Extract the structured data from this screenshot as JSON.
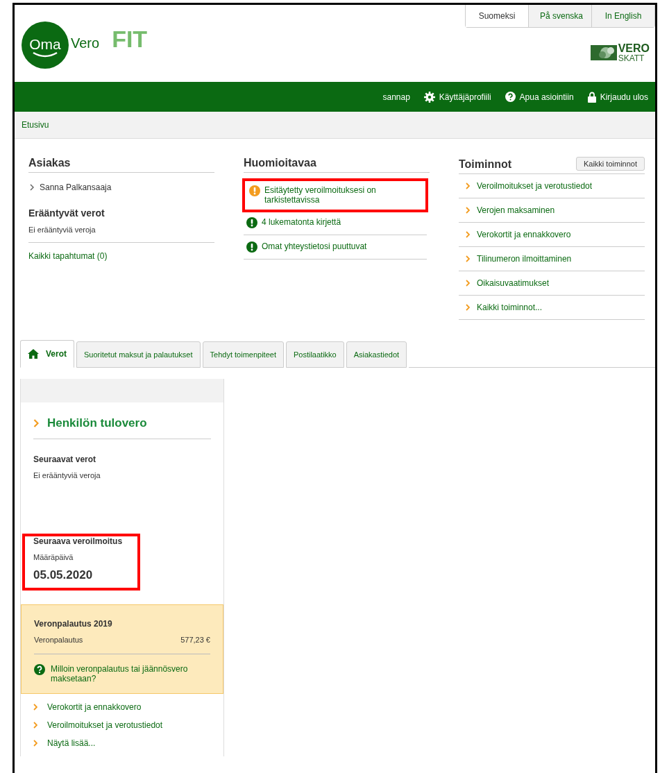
{
  "languages": [
    {
      "label": "Suomeksi",
      "selected": true
    },
    {
      "label": "På svenska",
      "selected": false
    },
    {
      "label": "In English",
      "selected": false
    }
  ],
  "logo": {
    "oma": "Oma",
    "vero": "Vero",
    "suffix": "FIT"
  },
  "brand": {
    "line1": "VERO",
    "line2": "SKATT"
  },
  "user_bar": {
    "user": "sannap",
    "links": [
      {
        "kind": "profile",
        "label": "Käyttäjäprofiili"
      },
      {
        "kind": "help",
        "label": "Apua asiointiin"
      },
      {
        "kind": "logout",
        "label": "Kirjaudu ulos"
      }
    ]
  },
  "breadcrumb": "Etusivu",
  "customer": {
    "title": "Asiakas",
    "name": "Sanna Palkansaaja",
    "due_title": "Erääntyvät verot",
    "due_text": "Ei erääntyviä veroja",
    "all_events": "Kaikki tapahtumat (0)"
  },
  "notices": {
    "title": "Huomioitavaa",
    "items": [
      {
        "kind": "warning",
        "text": "Esitäytetty veroilmoituksesi on tarkistettavissa",
        "highlighted": true
      },
      {
        "kind": "info",
        "text": "4 lukematonta kirjettä",
        "highlighted": false
      },
      {
        "kind": "info",
        "text": "Omat yhteystietosi puuttuvat",
        "highlighted": false
      }
    ]
  },
  "actions": {
    "title": "Toiminnot",
    "button": "Kaikki toiminnot",
    "links": [
      "Veroilmoitukset ja verotustiedot",
      "Verojen maksaminen",
      "Verokortit ja ennakkovero",
      "Tilinumeron ilmoittaminen",
      "Oikaisuvaatimukset",
      "Kaikki toiminnot..."
    ]
  },
  "tabs": [
    {
      "kind": "home",
      "label": "Verot",
      "selected": true
    },
    {
      "kind": "plain",
      "label": "Suoritetut maksut ja palautukset",
      "selected": false
    },
    {
      "kind": "plain",
      "label": "Tehdyt toimenpiteet",
      "selected": false
    },
    {
      "kind": "plain",
      "label": "Postilaatikko",
      "selected": false
    },
    {
      "kind": "plain",
      "label": "Asiakastiedot",
      "selected": false
    }
  ],
  "tax_panel": {
    "title": "Henkilön tulovero",
    "upcoming_title": "Seuraavat verot",
    "upcoming_text": "Ei erääntyviä veroja",
    "next_return": {
      "title": "Seuraava veroilmoitus",
      "label": "Määräpäivä",
      "date": "05.05.2020",
      "highlighted": true
    },
    "refund": {
      "title": "Veronpalautus 2019",
      "label": "Veronpalautus",
      "amount": "577,23 €",
      "question": "Milloin veronpalautus tai jäännösvero maksetaan?"
    },
    "links": [
      "Verokortit ja ennakkovero",
      "Veroilmoitukset ja verotustiedot",
      "Näytä lisää..."
    ]
  }
}
